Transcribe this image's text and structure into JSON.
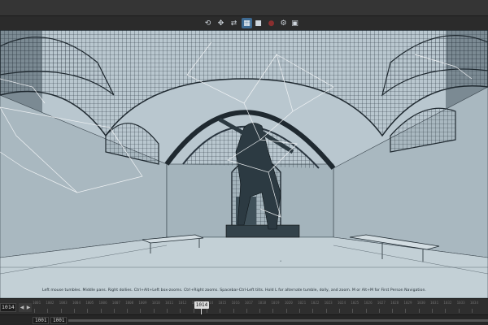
{
  "toolbar": {
    "buttons": [
      {
        "icon": "tumble-icon",
        "glyph": "⟲"
      },
      {
        "icon": "pan-icon",
        "glyph": "✥"
      },
      {
        "icon": "dolly-icon",
        "glyph": "⇄"
      },
      {
        "icon": "wireframe-shading-icon",
        "glyph": "▦"
      },
      {
        "icon": "camera-icon",
        "glyph": "■"
      },
      {
        "icon": "record-icon",
        "glyph": "●"
      },
      {
        "icon": "gear-icon",
        "glyph": "⚙"
      },
      {
        "icon": "snapshot-icon",
        "glyph": "▣"
      }
    ]
  },
  "viewport": {
    "hint": "Left mouse tumbles. Middle pans. Right dollies. Ctrl+Alt+Left box-zooms. Ctrl+Right zooms. Spacebar-Ctrl-Left tilts. Hold L for alternate tumble, dolly, and zoom.    M or Alt+M for First Person Navigation."
  },
  "timeline": {
    "current_frame_field": "1014",
    "current_frame": "1014",
    "ticks": [
      "1001",
      "1002",
      "1003",
      "1004",
      "1005",
      "1006",
      "1007",
      "1008",
      "1009",
      "1010",
      "1011",
      "1012",
      "1013",
      "1014",
      "1015",
      "1016",
      "1017",
      "1018",
      "1019",
      "1020",
      "1021",
      "1022",
      "1023",
      "1024",
      "1025",
      "1026",
      "1027",
      "1028",
      "1029",
      "1030",
      "1031",
      "1032",
      "1033",
      "1034"
    ]
  },
  "range": {
    "start": "1001",
    "playback_start": "1001"
  }
}
